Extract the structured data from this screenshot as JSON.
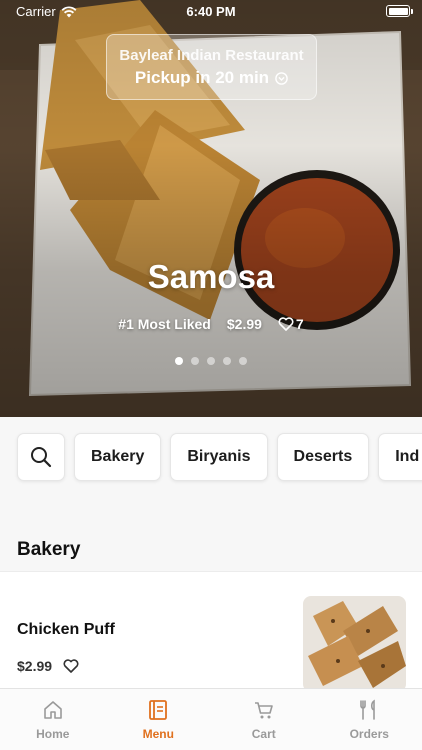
{
  "status_bar": {
    "carrier": "Carrier",
    "time": "6:40 PM"
  },
  "hero": {
    "restaurant_name": "Bayleaf Indian Restaurant",
    "pickup_text": "Pickup in 20 min",
    "dish_title": "Samosa",
    "rank_text": "#1 Most Liked",
    "price": "$2.99",
    "likes": "7",
    "carousel": {
      "page_count": 5,
      "active_index": 0
    }
  },
  "categories": {
    "search_icon": "search-icon",
    "items": [
      {
        "label": "Bakery"
      },
      {
        "label": "Biryanis"
      },
      {
        "label": "Deserts"
      },
      {
        "label": "Ind"
      }
    ]
  },
  "section": {
    "title": "Bakery"
  },
  "menu_items": [
    {
      "name": "Chicken Puff",
      "price": "$2.99"
    }
  ],
  "tab_bar": {
    "accent_color": "#e0711f",
    "tabs": [
      {
        "label": "Home",
        "icon": "home-icon",
        "active": false
      },
      {
        "label": "Menu",
        "icon": "menu-icon",
        "active": true
      },
      {
        "label": "Cart",
        "icon": "cart-icon",
        "active": false
      },
      {
        "label": "Orders",
        "icon": "orders-icon",
        "active": false
      }
    ]
  }
}
